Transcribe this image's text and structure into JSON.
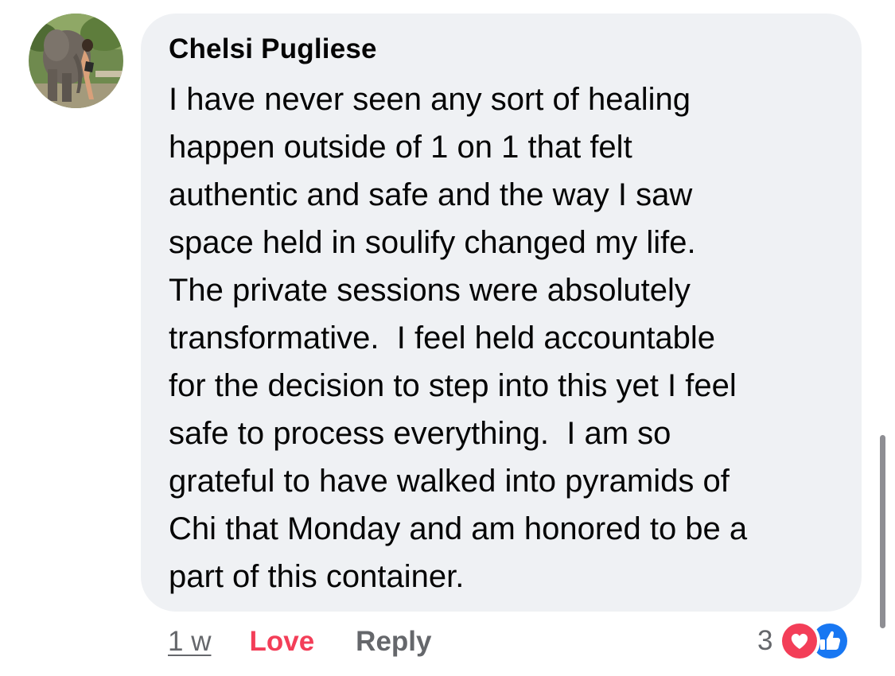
{
  "comment": {
    "author": "Chelsi Pugliese",
    "avatar_icon": "profile-photo-person-with-elephant",
    "body_lines": [
      "I have never seen any sort of healing",
      "happen outside of 1 on 1 that felt",
      "authentic and safe and the way I saw",
      "space held in soulify changed my life.",
      "The private sessions were absolutely",
      "transformative.  I feel held accountable",
      "for the decision to step into this yet I feel",
      "safe to process everything.  I am so",
      "grateful to have walked into pyramids of",
      "Chi that Monday and am honored to be a",
      "part of this container."
    ]
  },
  "actions": {
    "timestamp": "1 w",
    "love_label": "Love",
    "reply_label": "Reply"
  },
  "reactions": {
    "count": "3",
    "icons": [
      "love-reaction-icon",
      "like-reaction-icon"
    ]
  },
  "colors": {
    "bubble_bg": "#eff1f4",
    "text": "#050505",
    "secondary_text": "#65676b",
    "love": "#f33e58",
    "like": "#1877f2"
  }
}
